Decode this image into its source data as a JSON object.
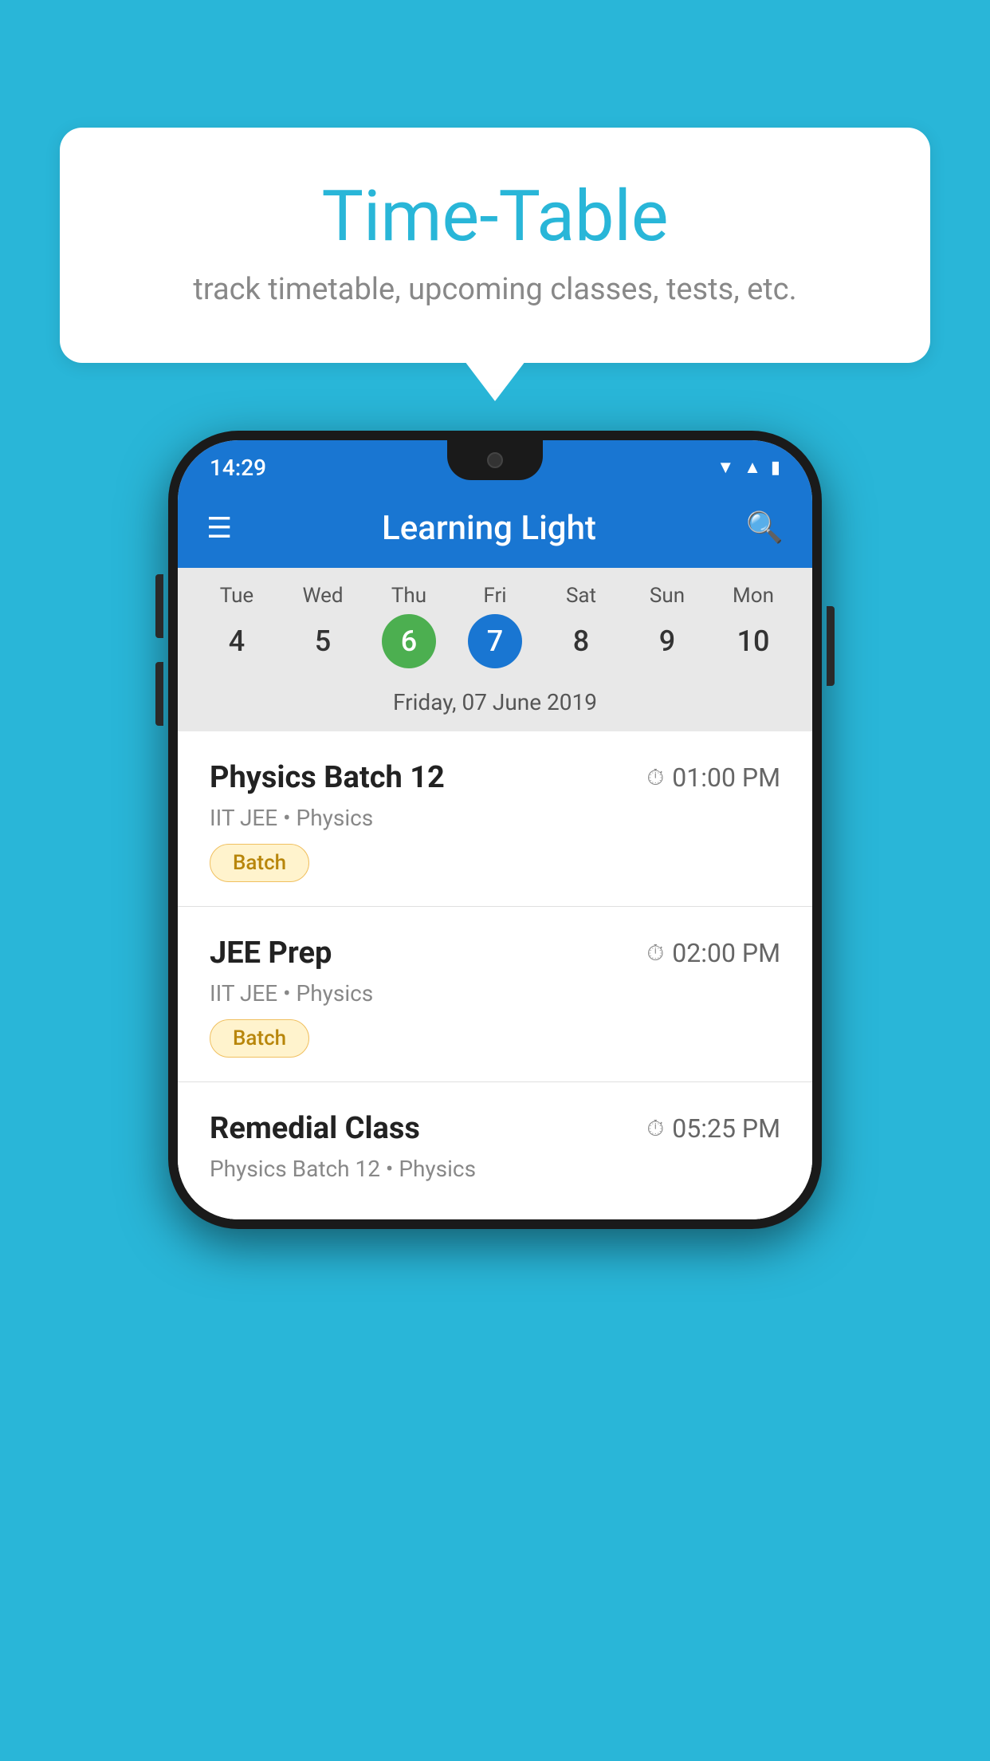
{
  "background_color": "#29b6d8",
  "speech_bubble": {
    "title": "Time-Table",
    "subtitle": "track timetable, upcoming classes, tests, etc."
  },
  "phone": {
    "status_bar": {
      "time": "14:29"
    },
    "app_bar": {
      "title": "Learning Light"
    },
    "calendar": {
      "days": [
        {
          "name": "Tue",
          "number": "4",
          "state": "normal"
        },
        {
          "name": "Wed",
          "number": "5",
          "state": "normal"
        },
        {
          "name": "Thu",
          "number": "6",
          "state": "today"
        },
        {
          "name": "Fri",
          "number": "7",
          "state": "selected"
        },
        {
          "name": "Sat",
          "number": "8",
          "state": "normal"
        },
        {
          "name": "Sun",
          "number": "9",
          "state": "normal"
        },
        {
          "name": "Mon",
          "number": "10",
          "state": "normal"
        }
      ],
      "selected_date_label": "Friday, 07 June 2019"
    },
    "schedule": [
      {
        "name": "Physics Batch 12",
        "time": "01:00 PM",
        "sub": "IIT JEE • Physics",
        "badge": "Batch"
      },
      {
        "name": "JEE Prep",
        "time": "02:00 PM",
        "sub": "IIT JEE • Physics",
        "badge": "Batch"
      },
      {
        "name": "Remedial Class",
        "time": "05:25 PM",
        "sub": "Physics Batch 12 • Physics",
        "badge": ""
      }
    ]
  }
}
